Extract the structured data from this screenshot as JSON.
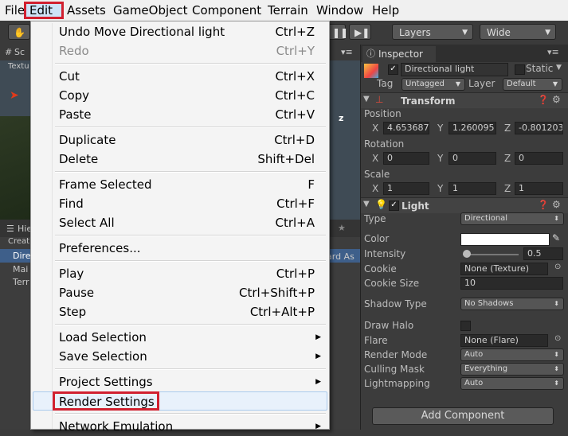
{
  "menubar": {
    "items": [
      {
        "label": "File"
      },
      {
        "label": "Edit"
      },
      {
        "label": "Assets"
      },
      {
        "label": "GameObject"
      },
      {
        "label": "Component"
      },
      {
        "label": "Terrain"
      },
      {
        "label": "Window"
      },
      {
        "label": "Help"
      }
    ]
  },
  "toolbar": {
    "layers_label": "Layers",
    "layout_label": "Wide"
  },
  "scene": {
    "tab_label": "Sc",
    "sub_label": "Textu",
    "axis_label": "z"
  },
  "hierarchy": {
    "tab_label": "Hie",
    "create_label": "Creat",
    "items": [
      "Dire",
      "Mai",
      "Terr"
    ],
    "right_label": "ard As"
  },
  "edit_menu": {
    "items": [
      {
        "label": "Undo Move Directional light",
        "shortcut": "Ctrl+Z",
        "disabled": false
      },
      {
        "label": "Redo",
        "shortcut": "Ctrl+Y",
        "disabled": true
      },
      {
        "label": "Cut",
        "shortcut": "Ctrl+X"
      },
      {
        "label": "Copy",
        "shortcut": "Ctrl+C"
      },
      {
        "label": "Paste",
        "shortcut": "Ctrl+V"
      },
      {
        "label": "Duplicate",
        "shortcut": "Ctrl+D"
      },
      {
        "label": "Delete",
        "shortcut": "Shift+Del"
      },
      {
        "label": "Frame Selected",
        "shortcut": "F"
      },
      {
        "label": "Find",
        "shortcut": "Ctrl+F"
      },
      {
        "label": "Select All",
        "shortcut": "Ctrl+A"
      },
      {
        "label": "Preferences...",
        "shortcut": ""
      },
      {
        "label": "Play",
        "shortcut": "Ctrl+P"
      },
      {
        "label": "Pause",
        "shortcut": "Ctrl+Shift+P"
      },
      {
        "label": "Step",
        "shortcut": "Ctrl+Alt+P"
      },
      {
        "label": "Load Selection",
        "shortcut": ""
      },
      {
        "label": "Save Selection",
        "shortcut": ""
      },
      {
        "label": "Project Settings",
        "shortcut": ""
      },
      {
        "label": "Render Settings",
        "shortcut": ""
      },
      {
        "label": "Network Emulation",
        "shortcut": ""
      }
    ]
  },
  "inspector": {
    "tab_label": "Inspector",
    "object_name": "Directional light",
    "static_label": "Static",
    "tag_label": "Tag",
    "tag_value": "Untagged",
    "layer_label": "Layer",
    "layer_value": "Default",
    "transform": {
      "title": "Transform",
      "position_label": "Position",
      "position": {
        "x": "4.653687",
        "y": "1.260095",
        "z": "-0.801203"
      },
      "rotation_label": "Rotation",
      "rotation": {
        "x": "0",
        "y": "0",
        "z": "0"
      },
      "scale_label": "Scale",
      "scale": {
        "x": "1",
        "y": "1",
        "z": "1"
      }
    },
    "light": {
      "title": "Light",
      "type_label": "Type",
      "type_value": "Directional",
      "color_label": "Color",
      "intensity_label": "Intensity",
      "intensity_value": "0.5",
      "cookie_label": "Cookie",
      "cookie_value": "None (Texture)",
      "cookie_size_label": "Cookie Size",
      "cookie_size_value": "10",
      "shadow_type_label": "Shadow Type",
      "shadow_type_value": "No Shadows",
      "draw_halo_label": "Draw Halo",
      "flare_label": "Flare",
      "flare_value": "None (Flare)",
      "render_mode_label": "Render Mode",
      "render_mode_value": "Auto",
      "culling_mask_label": "Culling Mask",
      "culling_mask_value": "Everything",
      "lightmapping_label": "Lightmapping",
      "lightmapping_value": "Auto"
    },
    "add_component_label": "Add Component"
  },
  "axis_labels": {
    "x": "X",
    "y": "Y",
    "z": "Z"
  },
  "colors": {
    "highlight_border": "#d1202f",
    "menu_bg": "#f4f4f4",
    "inspector_bg": "#3c3c3c"
  }
}
